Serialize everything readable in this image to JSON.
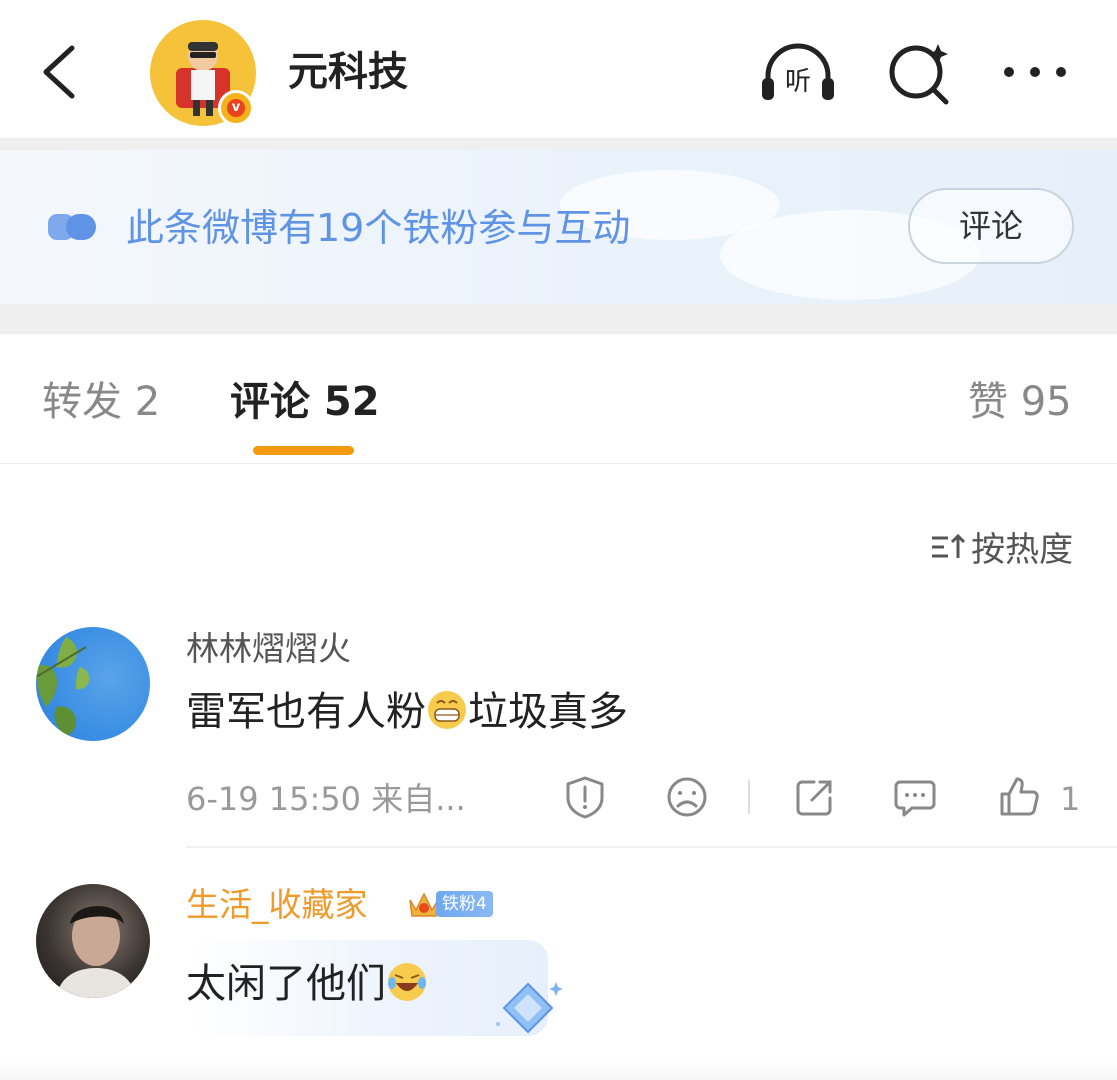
{
  "header": {
    "title": "元科技",
    "icons": [
      "back-icon",
      "listen-icon",
      "ai-search-icon",
      "more-icon"
    ],
    "listen_label": "听"
  },
  "fans_banner": {
    "text": "此条微博有19个铁粉参与互动",
    "button_label": "评论",
    "accent_color": "#5f93e6"
  },
  "tabs": {
    "repost": "转发 2",
    "comments": "评论 52",
    "likes": "赞 95",
    "active": "comments",
    "underline_color": "#f29a10"
  },
  "sort": {
    "label": "按热度"
  },
  "comments": [
    {
      "username": "林林熠熠火",
      "text_before": "雷军也有人粉",
      "emoji": "grin-emoji",
      "text_after": "垃圾真多",
      "meta": "6-19 15:50 来自...",
      "like_count": "1"
    },
    {
      "username": "生活_收藏家",
      "name_color": "#f09a2b",
      "fan_badge": "铁粉4",
      "text_before": "太闲了他们",
      "emoji": "laugh-cry-emoji"
    }
  ]
}
